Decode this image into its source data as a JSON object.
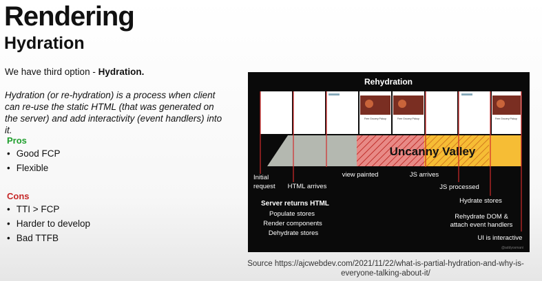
{
  "slide": {
    "title": "Rendering",
    "subtitle": "Hydration",
    "intro_prefix": "We have third option - ",
    "intro_bold": "Hydration.",
    "description": "Hydration (or re-hydration) is a process when client can re-use the static HTML (that was generated on the server) and add interactivity (event handlers) into it.",
    "pros_heading": "Pros",
    "pros": [
      "Good FCP",
      "Flexible"
    ],
    "cons_heading": "Cons",
    "cons": [
      "TTI > FCP",
      "Harder to develop",
      "Bad TTFB"
    ],
    "source": "Source https://ajcwebdev.com/2021/11/22/what-is-partial-hydration-and-why-is-everyone-talking-about-it/"
  },
  "diagram": {
    "title": "Rehydration",
    "band_label": "Uncanny Valley",
    "frame_text": "Free Grocery Pickup",
    "labels": {
      "initial_request_1": "Initial",
      "initial_request_2": "request",
      "html_arrives": "HTML arrives",
      "view_painted": "view painted",
      "js_arrives": "JS arrives",
      "js_processed": "JS processed",
      "hydrate_stores": "Hydrate stores",
      "rehydrate_dom_1": "Rehydrate DOM &",
      "rehydrate_dom_2": "attach event handlers",
      "ui_interactive": "UI is interactive",
      "server_returns_html": "Server returns HTML",
      "populate_stores": "Populate stores",
      "render_components": "Render components",
      "dehydrate_stores": "Dehydrate stores",
      "credit": "@addyosmani"
    },
    "colors": {
      "band_gray": "#b4b8b0",
      "band_red": "#e88a86",
      "band_yellow": "#f6bd35",
      "marker": "#d22b2b"
    }
  }
}
